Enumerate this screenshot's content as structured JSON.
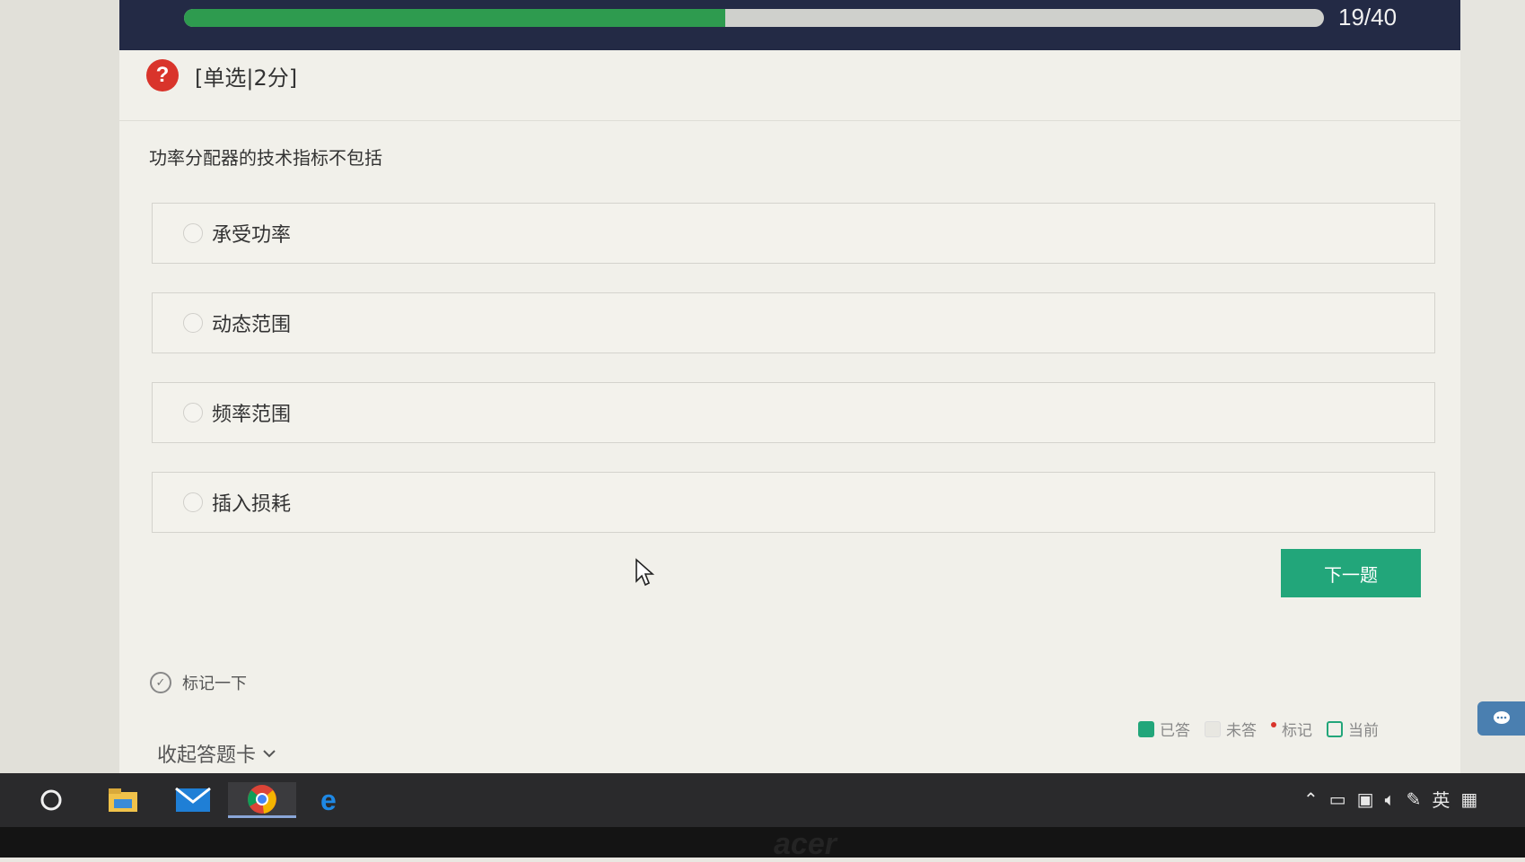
{
  "progress": {
    "text": "19/40",
    "fraction": 0.475,
    "color": "#2e9b4f"
  },
  "question": {
    "type_label": "[单选|2分]",
    "text": "功率分配器的技术指标不包括",
    "options": [
      {
        "label": "承受功率"
      },
      {
        "label": "动态范围"
      },
      {
        "label": "频率范围"
      },
      {
        "label": "插入损耗"
      }
    ]
  },
  "actions": {
    "next_label": "下一题",
    "mark_label": "标记一下",
    "collapse_label": "收起答题卡"
  },
  "legend": {
    "answered": "已答",
    "unanswered": "未答",
    "marked": "标记",
    "current": "当前"
  },
  "taskbar": {
    "icons": [
      "search-circle-icon",
      "file-explorer-icon",
      "mail-icon",
      "chrome-icon",
      "edge-icon"
    ],
    "tray_lang": "英"
  },
  "monitor_brand": "acer",
  "colors": {
    "accent": "#22a67a",
    "header": "#232a45",
    "help": "#d9342b"
  }
}
